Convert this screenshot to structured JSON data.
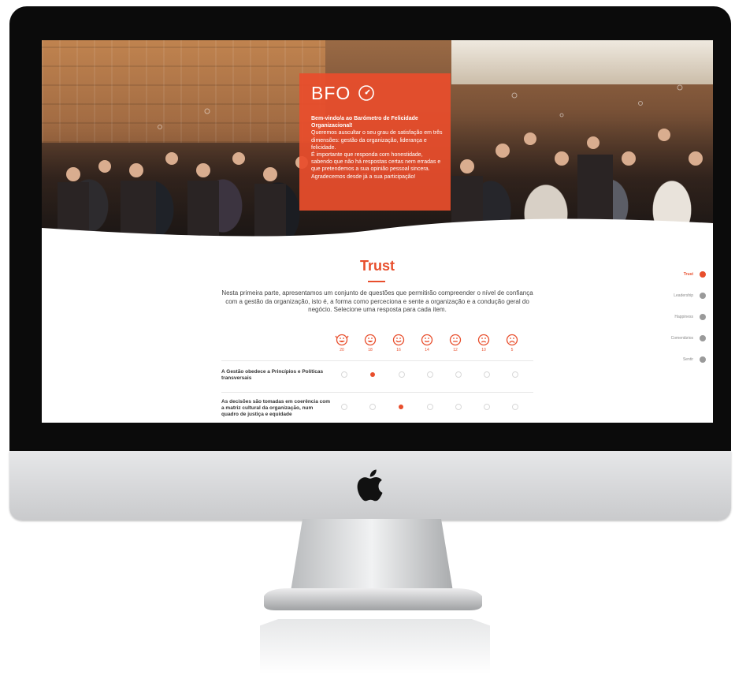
{
  "intro": {
    "title": "BFO",
    "heading": "Bem-vindo/a ao Barómetro de Felicidade Organizacional!",
    "line1": "Queremos auscultar o seu grau de satisfação em três dimensões: gestão da organização, liderança e felicidade.",
    "line2": "É importante que responda com honestidade, sabendo que não há respostas certas nem erradas e que pretendemos a sua opinião pessoal sincera.",
    "line3": "Agradecemos desde já a sua participação!"
  },
  "section": {
    "title": "Trust",
    "description": "Nesta primeira parte, apresentamos um conjunto de questões que permitirão compreender o nível de confiança com a gestão da organização, isto é, a forma como perceciona e sente a organização e a condução geral do negócio. Selecione uma resposta para cada item."
  },
  "scale": [
    {
      "score": "20",
      "icon": "ecstatic-face-icon"
    },
    {
      "score": "18",
      "icon": "grinning-face-icon"
    },
    {
      "score": "16",
      "icon": "smiling-face-icon"
    },
    {
      "score": "14",
      "icon": "slight-smile-face-icon"
    },
    {
      "score": "12",
      "icon": "neutral-face-icon"
    },
    {
      "score": "10",
      "icon": "frowning-face-icon"
    },
    {
      "score": "5",
      "icon": "sad-face-icon"
    }
  ],
  "questions": [
    {
      "label": "A Gestão obedece a Princípios e Políticas transversais",
      "selected_index": 1
    },
    {
      "label": "As decisões são tomadas em coerência com a matriz cultural da organização, num quadro de justiça e equidade",
      "selected_index": 2
    }
  ],
  "sidenav": [
    {
      "label": "Trust",
      "active": true
    },
    {
      "label": "Leadership",
      "active": false
    },
    {
      "label": "Happiness",
      "active": false
    },
    {
      "label": "Comentários",
      "active": false
    },
    {
      "label": "Sentir",
      "active": false
    }
  ],
  "colors": {
    "accent": "#e84e2c",
    "bezel": "#0b0b0b",
    "aluminium": "#d6d7d9"
  }
}
